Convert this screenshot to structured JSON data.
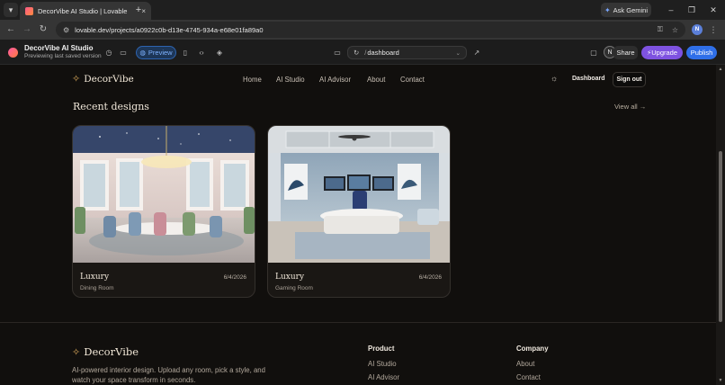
{
  "browser": {
    "tab_title": "DecorVibe AI Studio | Lovable",
    "tab_close": "×",
    "new_tab": "+",
    "tab_menu": "▾",
    "gemini_label": "Ask Gemini",
    "url": "lovable.dev/projects/a0922c0b-d13e-4745-934a-e68e01fa89a0",
    "profile_initial": "N",
    "window_controls": [
      "–",
      "❐",
      "✕"
    ]
  },
  "lovable": {
    "project_name": "DecorVibe AI Studio",
    "project_status": "Previewing last saved version",
    "preview_label": "Preview",
    "route": "dashboard",
    "avatar_initial": "N",
    "share_label": "Share",
    "upgrade_label": "Upgrade",
    "publish_label": "Publish"
  },
  "site": {
    "brand": "DecorVibe",
    "nav": [
      "Home",
      "AI Studio",
      "AI Advisor",
      "About",
      "Contact"
    ],
    "dashboard_label": "Dashboard",
    "signout_label": "Sign out",
    "section_title": "Recent designs",
    "view_all": "View all →",
    "designs": [
      {
        "style": "Luxury",
        "room": "Dining Room",
        "date": "6/4/2026"
      },
      {
        "style": "Luxury",
        "room": "Gaming Room",
        "date": "6/4/2026"
      }
    ],
    "footer": {
      "brand": "DecorVibe",
      "description": "AI-powered interior design. Upload any room, pick a style, and watch your space transform in seconds.",
      "product_heading": "Product",
      "product_links": [
        "AI Studio",
        "AI Advisor"
      ],
      "company_heading": "Company",
      "company_links": [
        "About",
        "Contact"
      ]
    }
  },
  "colors": {
    "accent_gold": "#d9a85b",
    "preview_blue": "#2e64b0",
    "upgrade_purple": "#7e52e0",
    "publish_blue": "#2f6fe8"
  }
}
